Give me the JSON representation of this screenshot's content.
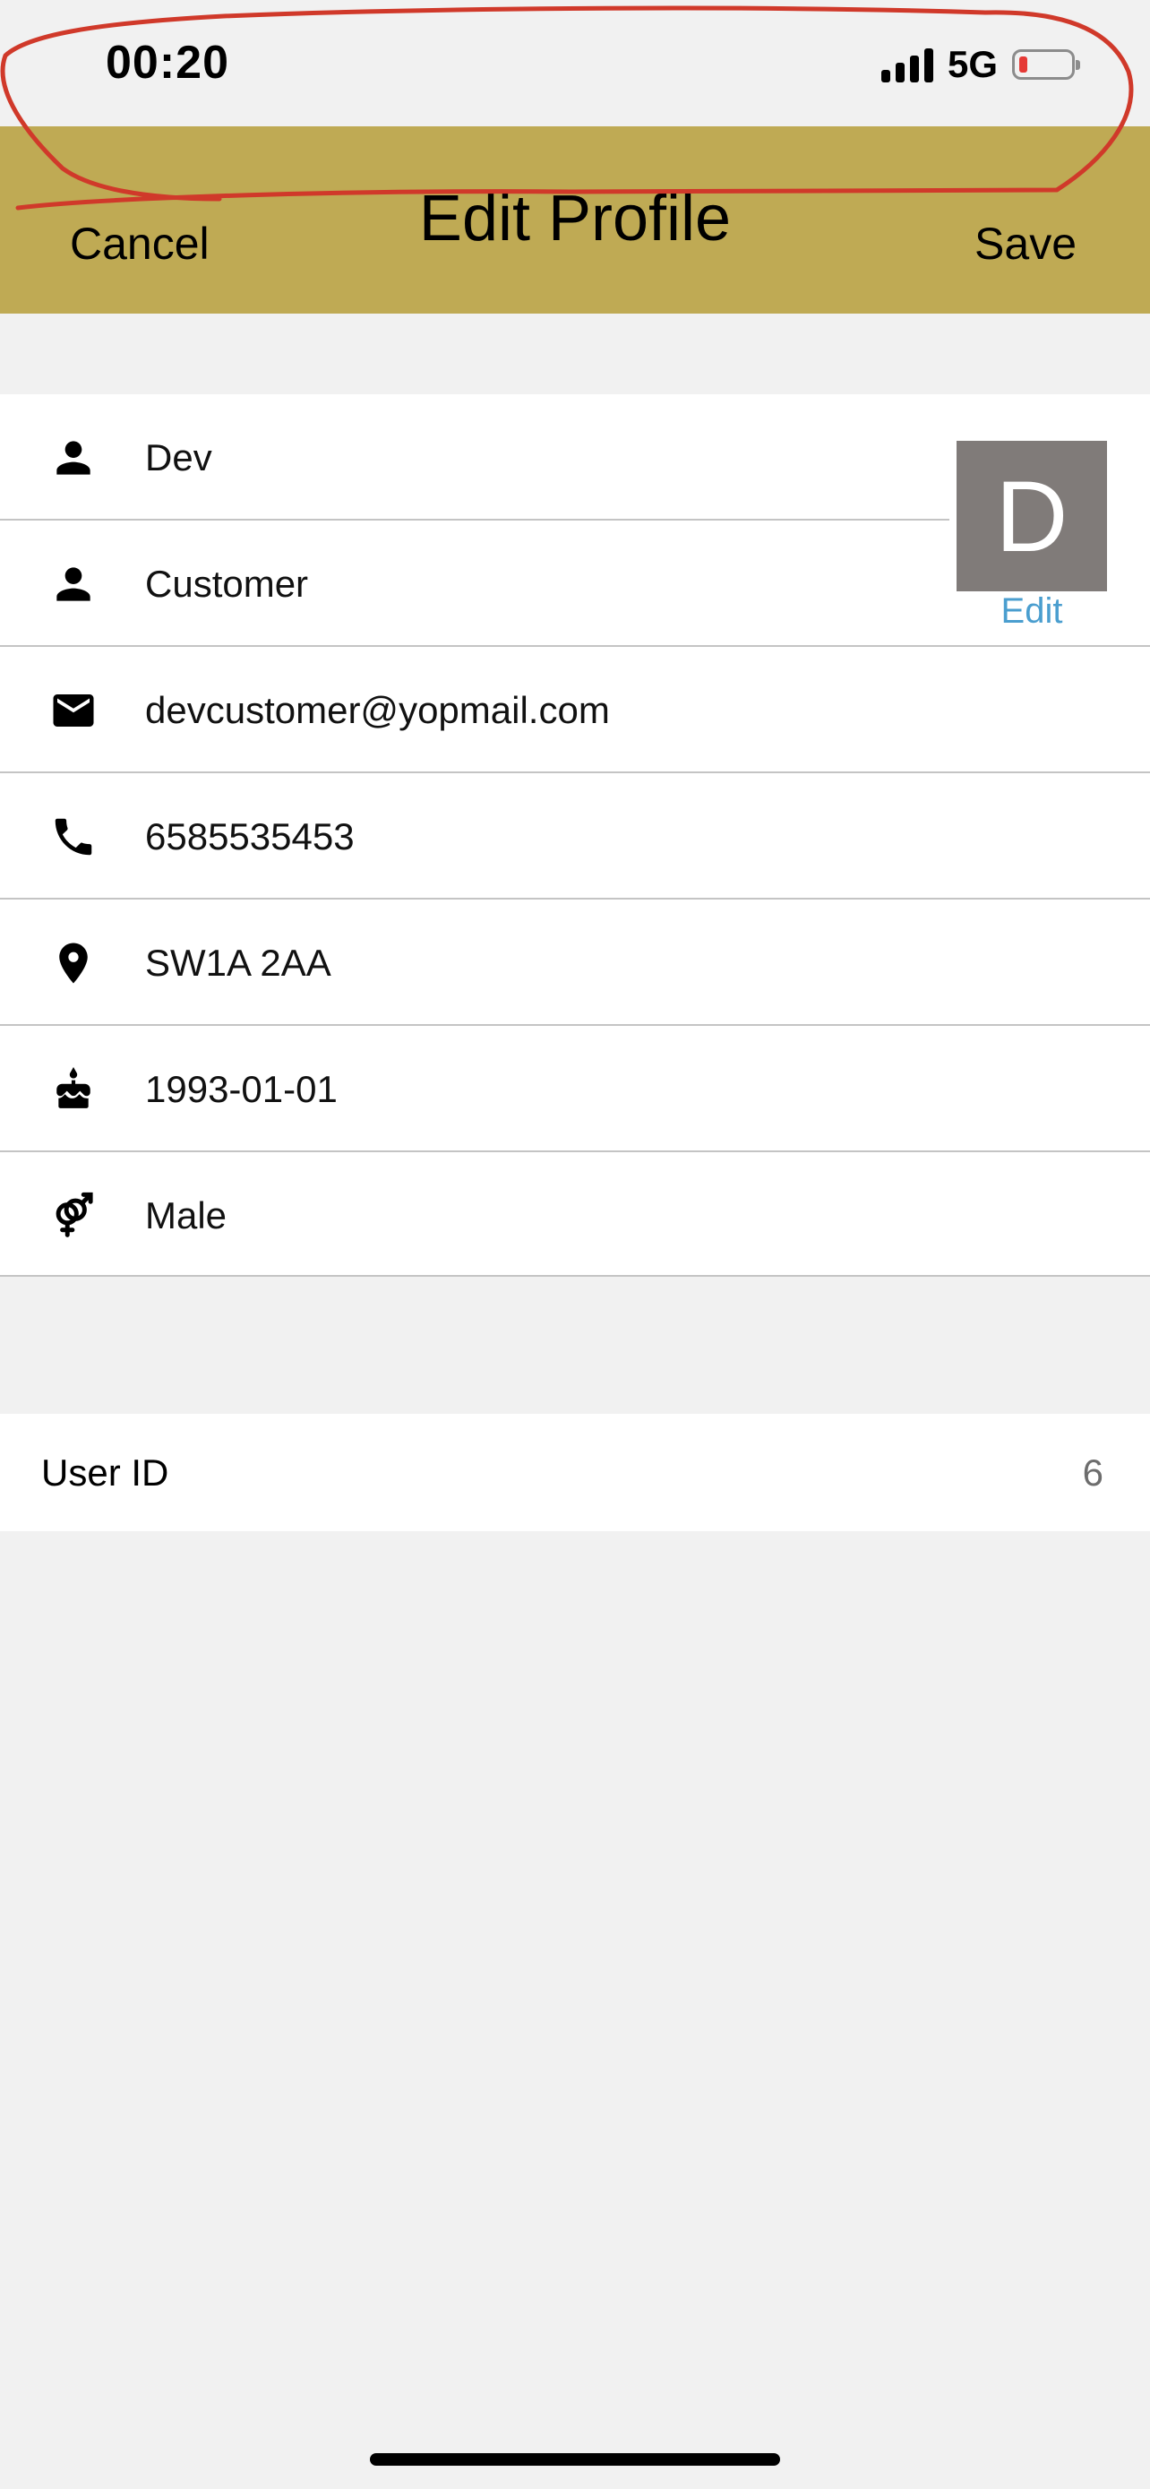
{
  "status_bar": {
    "time": "00:20",
    "network": "5G",
    "signal_icon": "signal-bars-icon",
    "battery_icon": "battery-low-icon",
    "battery_level": 0.1
  },
  "nav": {
    "title": "Edit Profile",
    "cancel_label": "Cancel",
    "save_label": "Save",
    "background_color": "#bfaa54"
  },
  "profile": {
    "avatar_letter": "D",
    "avatar_edit_label": "Edit",
    "fields": [
      {
        "icon": "person-icon",
        "value": "Dev"
      },
      {
        "icon": "person-icon",
        "value": "Customer"
      },
      {
        "icon": "email-icon",
        "value": "devcustomer@yopmail.com"
      },
      {
        "icon": "phone-icon",
        "value": "6585535453"
      },
      {
        "icon": "location-pin-icon",
        "value": "SW1A 2AA"
      },
      {
        "icon": "cake-icon",
        "value": "1993-01-01"
      },
      {
        "icon": "gender-icon",
        "value": "Male"
      }
    ]
  },
  "user_id": {
    "label": "User ID",
    "value": "6"
  },
  "annotation_color": "#d0392a"
}
